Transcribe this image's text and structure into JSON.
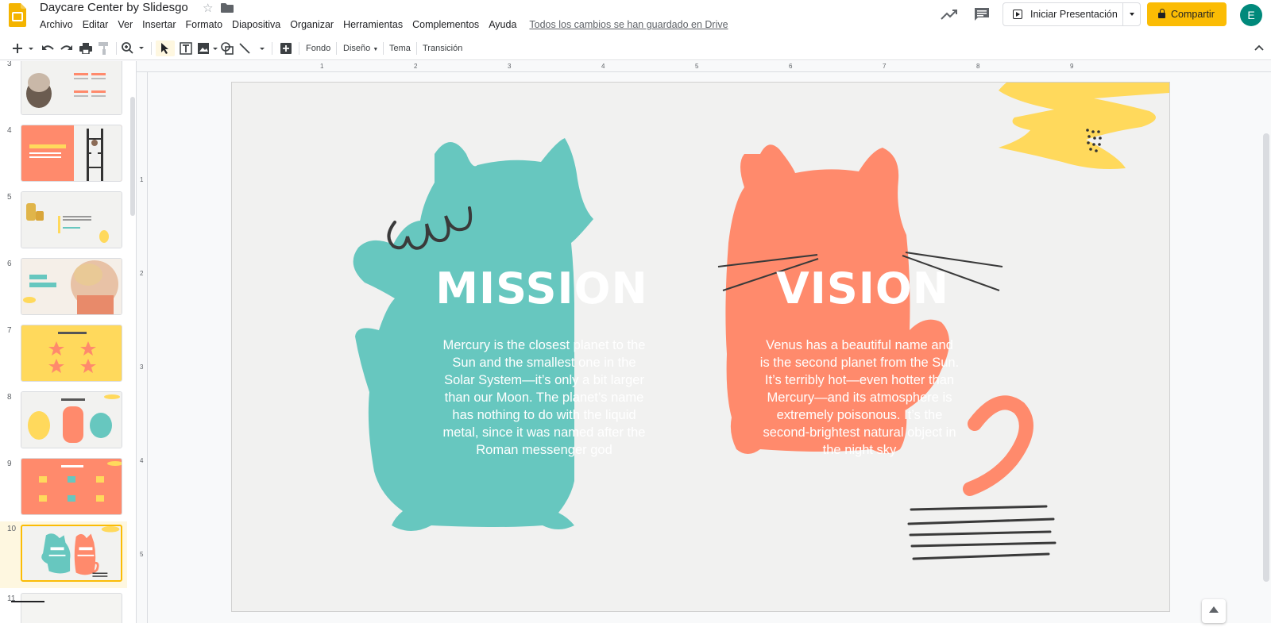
{
  "header": {
    "title": "Daycare Center by Slidesgo",
    "menu": [
      "Archivo",
      "Editar",
      "Ver",
      "Insertar",
      "Formato",
      "Diapositiva",
      "Organizar",
      "Herramientas",
      "Complementos",
      "Ayuda"
    ],
    "saved_status": "Todos los cambios se han guardado en Drive",
    "present_label": "Iniciar Presentación",
    "share_label": "Compartir",
    "avatar_initial": "E"
  },
  "toolbar": {
    "fondo": "Fondo",
    "diseno": "Diseño",
    "tema": "Tema",
    "transicion": "Transición"
  },
  "filmstrip": {
    "slides": [
      {
        "num": "3"
      },
      {
        "num": "4"
      },
      {
        "num": "5"
      },
      {
        "num": "6"
      },
      {
        "num": "7"
      },
      {
        "num": "8"
      },
      {
        "num": "9"
      },
      {
        "num": "10",
        "selected": true
      },
      {
        "num": "11"
      }
    ]
  },
  "ruler": {
    "h_numbers": [
      "1",
      "2",
      "3",
      "4",
      "5",
      "6",
      "7",
      "8",
      "9"
    ],
    "v_numbers": [
      "1",
      "2",
      "3",
      "4",
      "5"
    ]
  },
  "slide": {
    "mission_title": "MISSION",
    "mission_text": "Mercury is the closest planet to the Sun and the smallest one in the Solar System—it’s only a bit larger than our Moon. The planet’s name has nothing to do with the liquid metal, since it was named after the Roman messenger god",
    "vision_title": "VISION",
    "vision_text": "Venus has a beautiful name and is the second planet from the Sun. It’s terribly hot—even hotter than Mercury—and its atmosphere is extremely poisonous. It’s the second-brightest natural object in the night sky",
    "colors": {
      "teal": "#67c7bf",
      "salmon": "#ff8a6c",
      "yellow": "#ffd95c",
      "text_light": "#ffffff"
    }
  }
}
